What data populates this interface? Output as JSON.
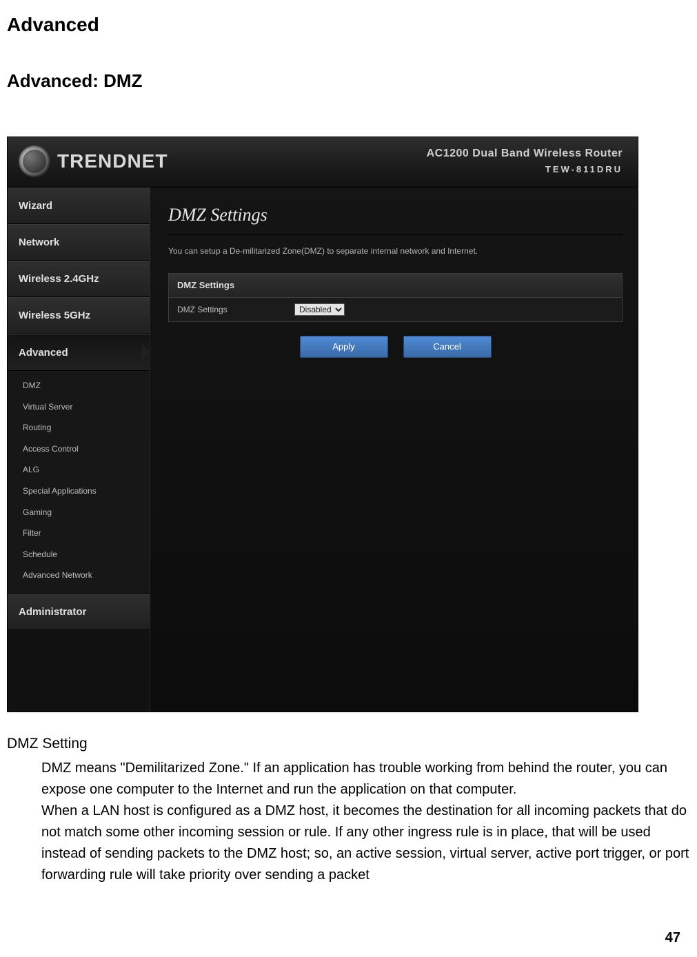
{
  "doc": {
    "title1": "Advanced",
    "title2": "Advanced: DMZ",
    "section_heading": "DMZ Setting",
    "para1": "DMZ means \"Demilitarized Zone.\" If an application has trouble working from behind the router, you can expose one computer to the Internet and run the application on that computer.",
    "para2": "When a LAN host is configured as a DMZ host, it becomes the destination for all incoming packets that do not match some other incoming session or rule. If any other ingress rule is in place, that will be used instead of sending packets to the DMZ host; so, an active session, virtual server, active port trigger, or port forwarding rule will take priority over sending a packet",
    "page_number": "47"
  },
  "router": {
    "brand": "TRENDNET",
    "product_line1": "AC1200 Dual Band Wireless Router",
    "product_line2": "TEW-811DRU",
    "nav": {
      "items": [
        "Wizard",
        "Network",
        "Wireless 2.4GHz",
        "Wireless 5GHz",
        "Advanced",
        "Administrator"
      ],
      "active_index": 4,
      "sub": [
        "DMZ",
        "Virtual Server",
        "Routing",
        "Access Control",
        "ALG",
        "Special Applications",
        "Gaming",
        "Filter",
        "Schedule",
        "Advanced Network"
      ]
    },
    "content": {
      "title": "DMZ Settings",
      "desc": "You can setup a De-militarized Zone(DMZ) to separate internal network and Internet.",
      "panel_title": "DMZ Settings",
      "row_label": "DMZ Settings",
      "select_value": "Disabled",
      "apply": "Apply",
      "cancel": "Cancel"
    }
  }
}
